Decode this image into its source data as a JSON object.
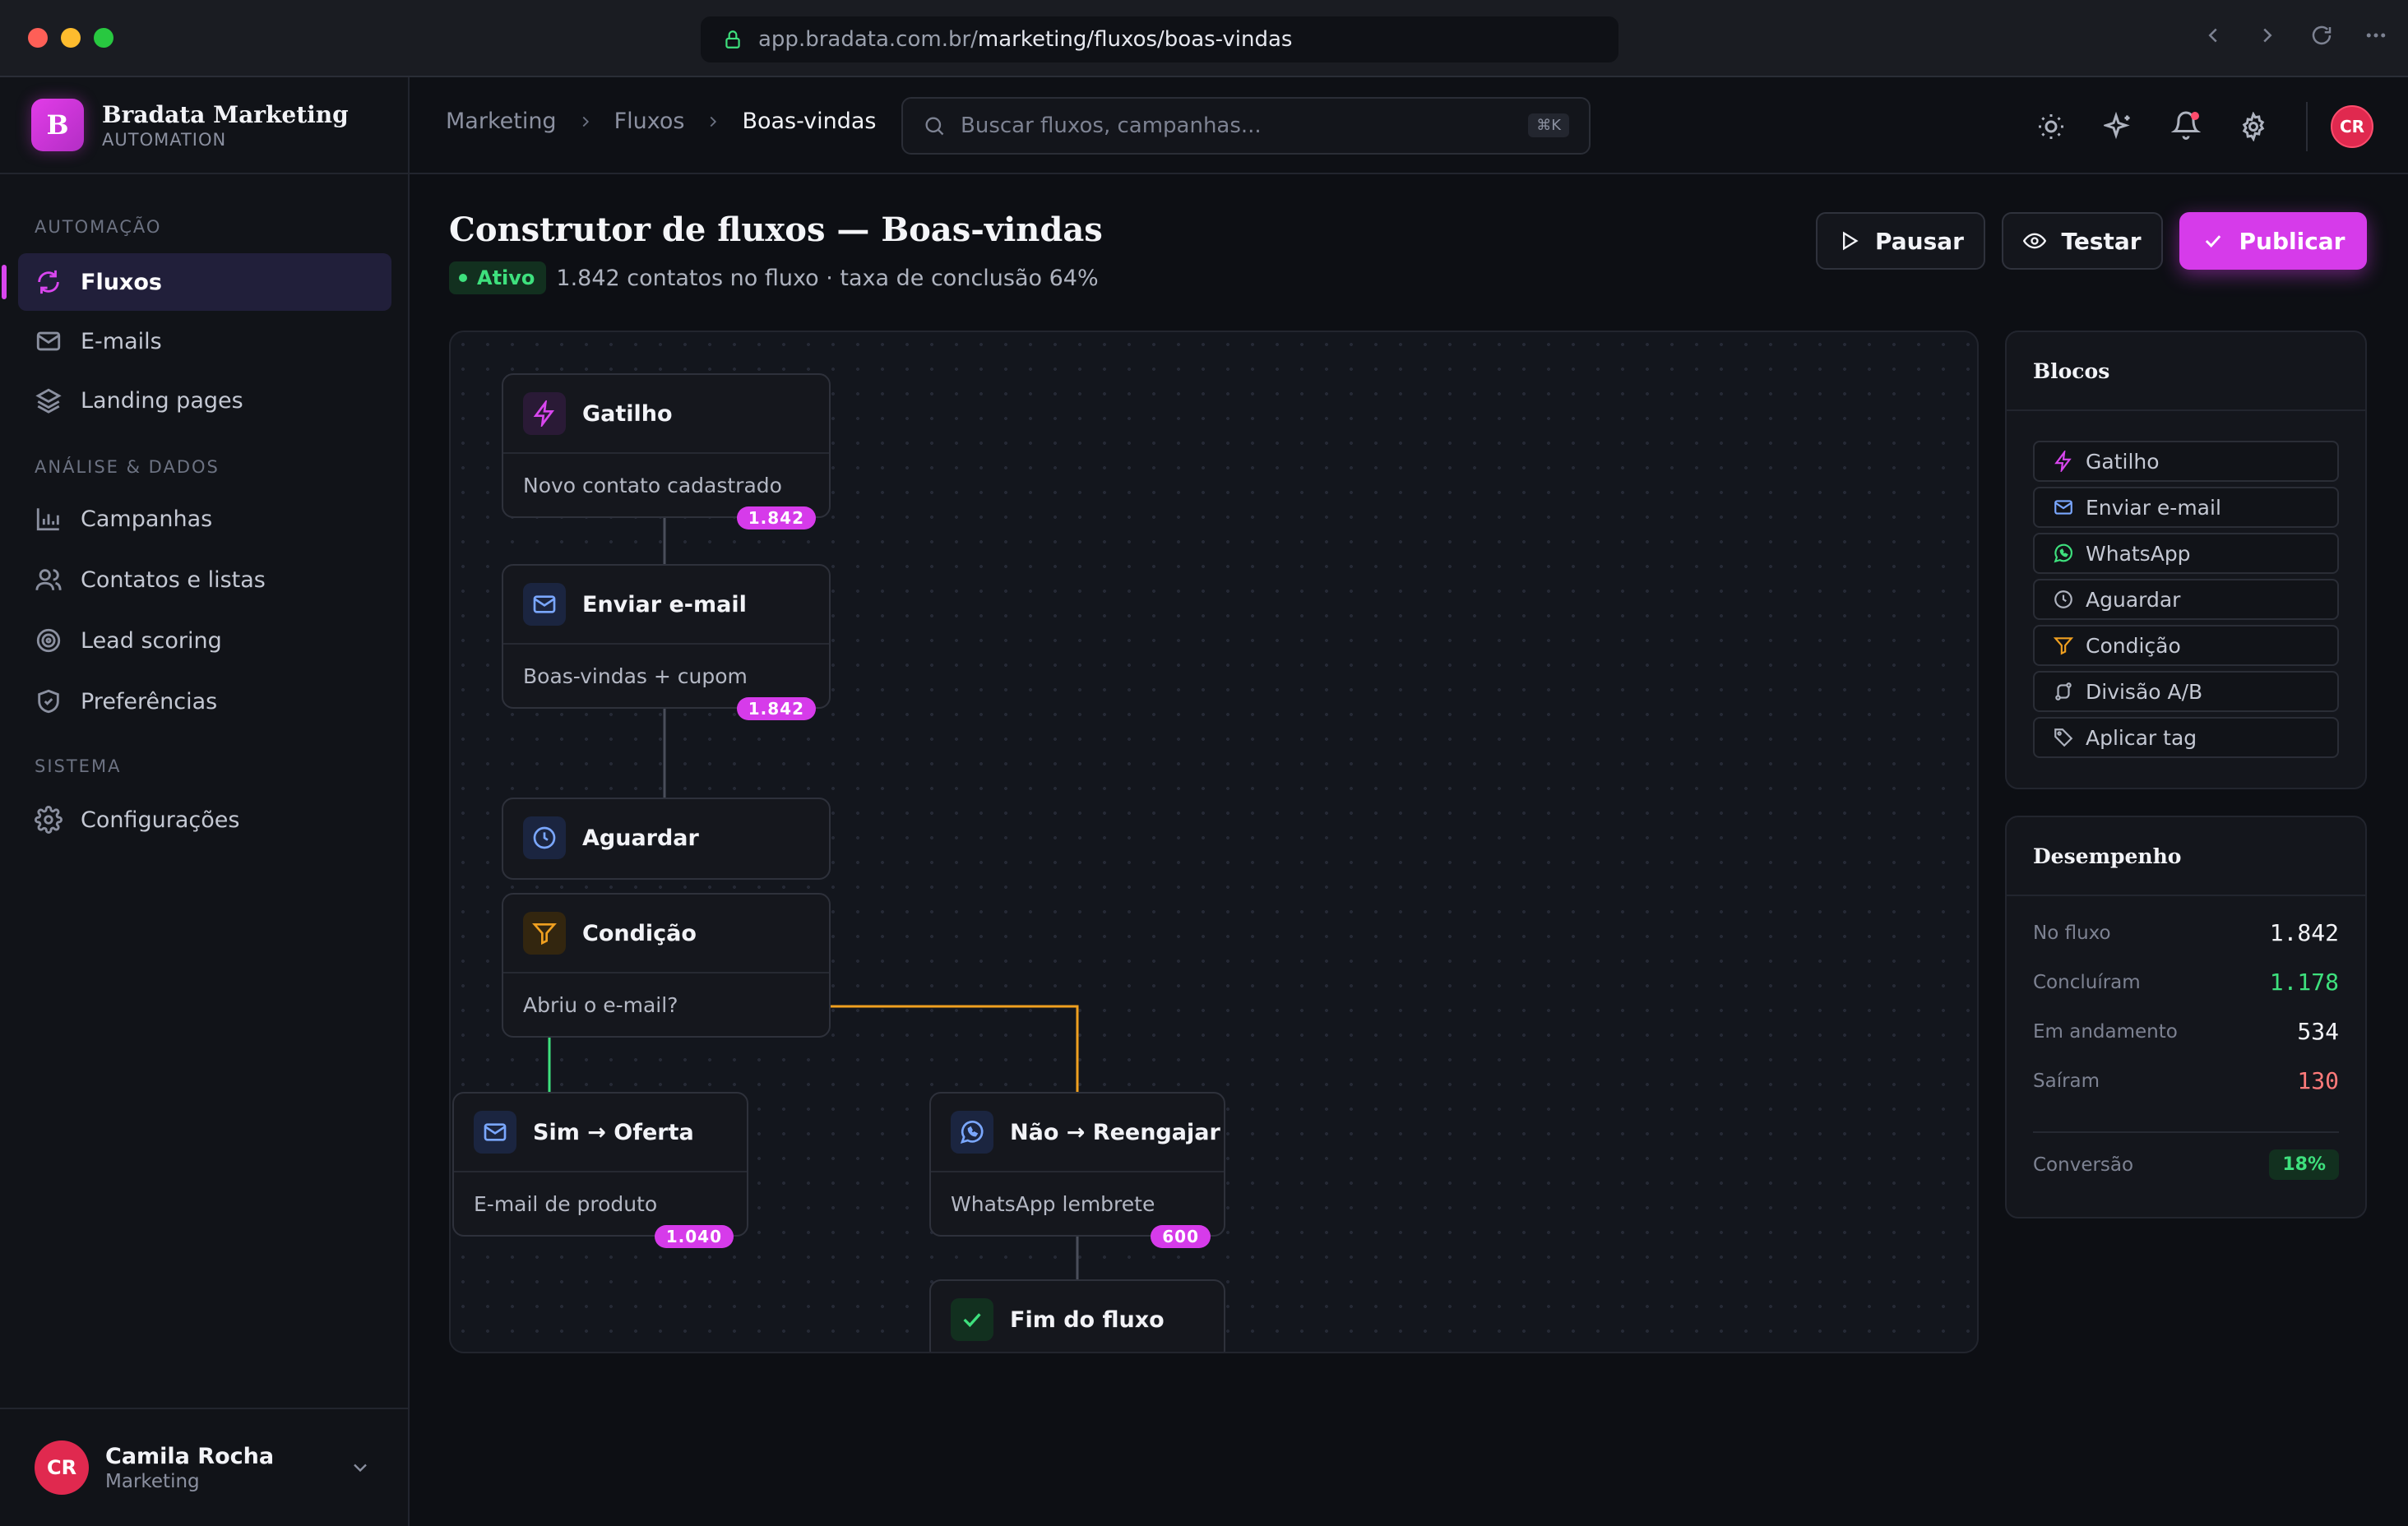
{
  "browser": {
    "url_host": "app.bradata.com.br/",
    "url_path": "marketing/fluxos/boas-vindas"
  },
  "brand": {
    "logo_letter": "B",
    "name": "Bradata Marketing",
    "sub": "AUTOMATION",
    "accent": "#d63bea"
  },
  "sidebar": {
    "sections": [
      "AUTOMAÇÃO",
      "ANÁLISE & DADOS",
      "SISTEMA"
    ],
    "items": [
      {
        "label": "Fluxos",
        "icon": "refresh-icon",
        "active": true
      },
      {
        "label": "E-mails",
        "icon": "mail-icon"
      },
      {
        "label": "Landing pages",
        "icon": "layers-icon"
      },
      {
        "label": "Campanhas",
        "icon": "bar-chart-icon"
      },
      {
        "label": "Contatos e listas",
        "icon": "users-icon"
      },
      {
        "label": "Lead scoring",
        "icon": "target-icon"
      },
      {
        "label": "Preferências",
        "icon": "shield-icon"
      },
      {
        "label": "Configurações",
        "icon": "gear-icon"
      }
    ]
  },
  "user": {
    "initials": "CR",
    "name": "Camila Rocha",
    "role": "Marketing"
  },
  "header": {
    "breadcrumb": [
      "Marketing",
      "Fluxos",
      "Boas-vindas"
    ],
    "search_placeholder": "Buscar fluxos, campanhas...",
    "search_shortcut": "⌘K",
    "avatar_initials": "CR"
  },
  "page": {
    "title": "Construtor de fluxos — Boas-vindas",
    "status": "Ativo",
    "summary": "1.842 contatos no fluxo · taxa de conclusão 64%",
    "buttons": {
      "pause": "Pausar",
      "test": "Testar",
      "publish": "Publicar"
    }
  },
  "flow": {
    "nodes": [
      {
        "title": "Gatilho",
        "body": "Novo contato cadastrado",
        "count": "1.842",
        "icon": "bolt-icon"
      },
      {
        "title": "Enviar e-mail",
        "body": "Boas-vindas + cupom",
        "count": "1.842",
        "icon": "mail-icon"
      },
      {
        "title": "Aguardar",
        "icon": "clock-icon"
      },
      {
        "title": "Condição",
        "body": "Abriu o e-mail?",
        "icon": "filter-icon"
      },
      {
        "title": "Sim → Oferta",
        "body": "E-mail de produto",
        "count": "1.040",
        "icon": "mail-icon"
      },
      {
        "title": "Não → Reengajar",
        "body": "WhatsApp lembrete",
        "count": "600",
        "icon": "whatsapp-icon"
      },
      {
        "title": "Fim do fluxo",
        "icon": "check-icon"
      }
    ],
    "branch_yes_color": "#3ee07d",
    "branch_no_color": "#f0a020"
  },
  "blocks_panel": {
    "title": "Blocos",
    "items": [
      {
        "label": "Gatilho",
        "icon": "bolt-icon"
      },
      {
        "label": "Enviar e-mail",
        "icon": "mail-icon"
      },
      {
        "label": "WhatsApp",
        "icon": "whatsapp-icon"
      },
      {
        "label": "Aguardar",
        "icon": "clock-icon"
      },
      {
        "label": "Condição",
        "icon": "filter-icon"
      },
      {
        "label": "Divisão A/B",
        "icon": "split-icon"
      },
      {
        "label": "Aplicar tag",
        "icon": "tag-icon"
      }
    ]
  },
  "performance": {
    "title": "Desempenho",
    "rows": [
      {
        "label": "No fluxo",
        "value": "1.842"
      },
      {
        "label": "Concluíram",
        "value": "1.178",
        "color": "#3ee07d"
      },
      {
        "label": "Em andamento",
        "value": "534"
      },
      {
        "label": "Saíram",
        "value": "130",
        "color": "#ff7a7a"
      }
    ],
    "conversion_label": "Conversão",
    "conversion_value": "18%"
  }
}
